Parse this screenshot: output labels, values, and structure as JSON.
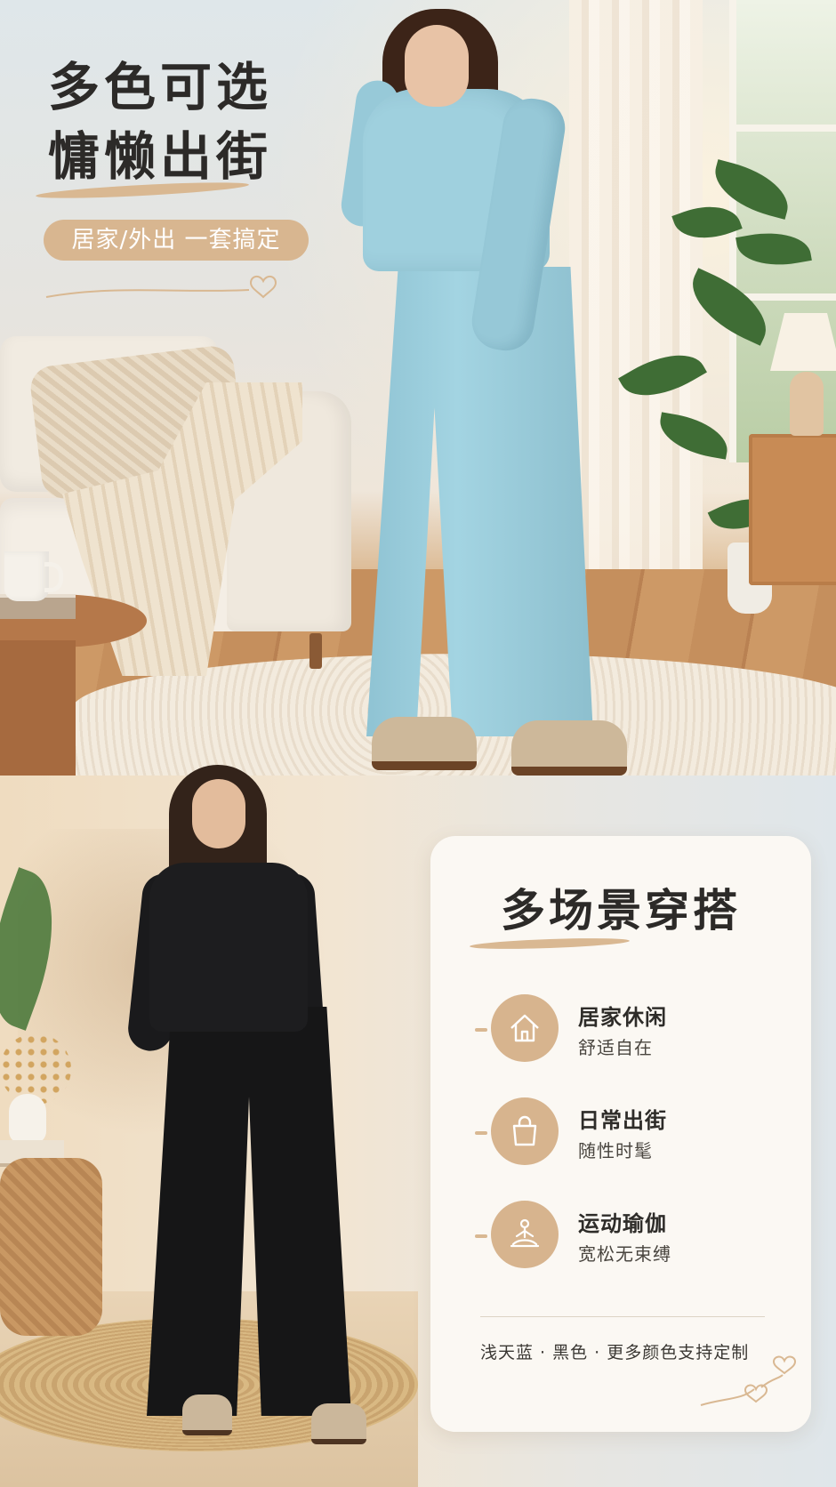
{
  "hero": {
    "title_line1": "多色可选",
    "title_line2": "慵懒出街",
    "pill_text": "居家/外出 一套搞定"
  },
  "card": {
    "title": "多场景穿搭",
    "features": [
      {
        "title": "居家休闲",
        "subtitle": "舒适自在",
        "icon": "house-icon"
      },
      {
        "title": "日常出街",
        "subtitle": "随性时髦",
        "icon": "shopping-bag-icon"
      },
      {
        "title": "运动瑜伽",
        "subtitle": "宽松无束缚",
        "icon": "yoga-icon"
      }
    ],
    "footer": "浅天蓝 · 黑色 · 更多颜色支持定制"
  },
  "colors": {
    "accent": "#d8b690",
    "light_blue_outfit": "#9fd0de",
    "black_outfit": "#1d1d1f",
    "title_text": "#2c2a28"
  }
}
